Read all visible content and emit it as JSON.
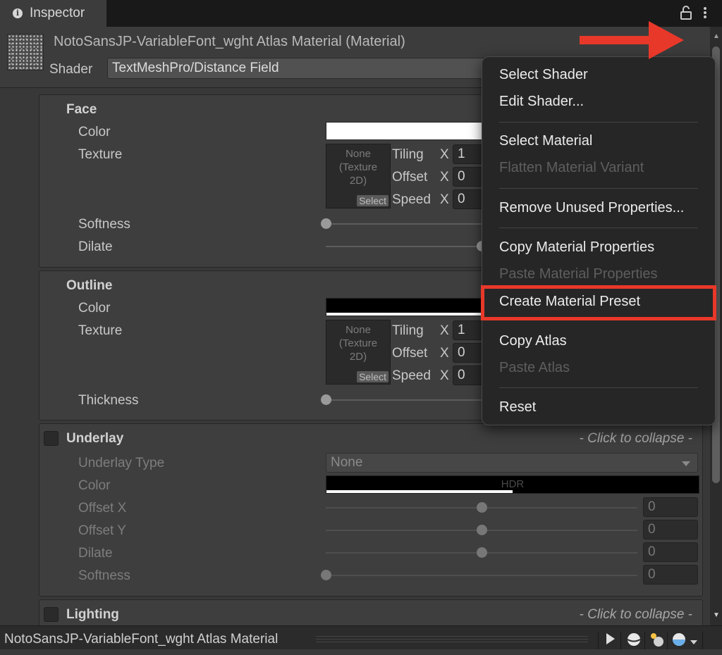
{
  "tab": {
    "title": "Inspector"
  },
  "header": {
    "material_title": "NotoSansJP-VariableFont_wght Atlas Material (Material)",
    "shader_label": "Shader",
    "shader_value": "TextMeshPro/Distance Field"
  },
  "face": {
    "title": "Face",
    "color_label": "Color",
    "texture_label": "Texture",
    "texture_none": "None\n(Texture\n2D)",
    "select_label": "Select",
    "tiling_label": "Tiling",
    "offset_label": "Offset",
    "speed_label": "Speed",
    "x_label": "X",
    "tiling_x": "1",
    "offset_x": "0",
    "speed_x": "0",
    "softness_label": "Softness",
    "dilate_label": "Dilate",
    "softness_value": 0.0,
    "dilate_value": 0.5
  },
  "outline": {
    "title": "Outline",
    "color_label": "Color",
    "texture_label": "Texture",
    "texture_none": "None\n(Texture\n2D)",
    "select_label": "Select",
    "tiling_label": "Tiling",
    "offset_label": "Offset",
    "speed_label": "Speed",
    "x_label": "X",
    "tiling_x": "1",
    "offset_x": "0",
    "speed_x": "0",
    "thickness_label": "Thickness",
    "thickness_value": 0.0
  },
  "underlay": {
    "title": "Underlay",
    "collapse_text": "- Click to collapse -",
    "type_label": "Underlay Type",
    "type_value": "None",
    "color_label": "Color",
    "hdr_label": "HDR",
    "offset_x_label": "Offset X",
    "offset_y_label": "Offset Y",
    "dilate_label": "Dilate",
    "softness_label": "Softness",
    "offset_x_value": "0",
    "offset_y_value": "0",
    "dilate_value": "0",
    "softness_value": "0"
  },
  "lighting": {
    "title": "Lighting",
    "collapse_text": "- Click to collapse -"
  },
  "context_menu": {
    "items": [
      {
        "label": "Select Shader",
        "enabled": true
      },
      {
        "label": "Edit Shader...",
        "enabled": true
      },
      {
        "label": "Select Material",
        "enabled": true
      },
      {
        "label": "Flatten Material Variant",
        "enabled": false
      },
      {
        "label": "Remove Unused Properties...",
        "enabled": true
      },
      {
        "label": "Copy Material Properties",
        "enabled": true
      },
      {
        "label": "Paste Material Properties",
        "enabled": false
      },
      {
        "label": "Create Material Preset",
        "enabled": true,
        "highlighted": true
      },
      {
        "label": "Copy Atlas",
        "enabled": true
      },
      {
        "label": "Paste Atlas",
        "enabled": false
      },
      {
        "label": "Reset",
        "enabled": true
      }
    ]
  },
  "bottom_bar": {
    "title": "NotoSansJP-VariableFont_wght Atlas Material"
  },
  "icons": {
    "tab_info": "info-icon",
    "lock": "lock-icon",
    "tab_menu": "kebab-icon",
    "preset": "preset-icon",
    "header_menu": "kebab-icon",
    "play": "play-icon",
    "sphere": "sphere-icon",
    "lights": "lights-icon",
    "skybox": "skybox-icon"
  },
  "colors": {
    "annotation_red": "#e8382a",
    "face_color": "#ffffff",
    "outline_color": "#000000",
    "underlay_color": "#000000"
  }
}
